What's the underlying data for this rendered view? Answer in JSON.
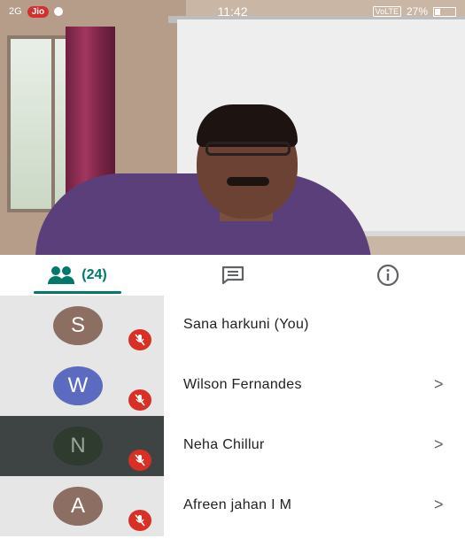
{
  "status_bar": {
    "signal": "2G",
    "carrier": "Jio",
    "time": "11:42",
    "volte": "VoLTE",
    "battery": "27%",
    "battery_level": 0.27
  },
  "tabs": {
    "people_count": "(24)",
    "active": "people"
  },
  "participants": [
    {
      "initial": "S",
      "name": "Sana harkuni (You)",
      "avatar_color": "#8d6e63",
      "muted": true,
      "chevron": "",
      "highlight": false
    },
    {
      "initial": "W",
      "name": "Wilson Fernandes",
      "avatar_color": "#5c6bc0",
      "muted": true,
      "chevron": ">",
      "highlight": false
    },
    {
      "initial": "N",
      "name": "Neha Chillur",
      "avatar_color": "#2e3b2e",
      "muted": true,
      "chevron": ">",
      "highlight": true
    },
    {
      "initial": "A",
      "name": "Afreen jahan I M",
      "avatar_color": "#8d6e63",
      "muted": true,
      "chevron": ">",
      "highlight": false
    }
  ],
  "colors": {
    "accent": "#00796b",
    "mute_red": "#d93025"
  },
  "icons": [
    "people-icon",
    "chat-icon",
    "info-icon",
    "mic-off-icon",
    "chevron-right-icon"
  ]
}
